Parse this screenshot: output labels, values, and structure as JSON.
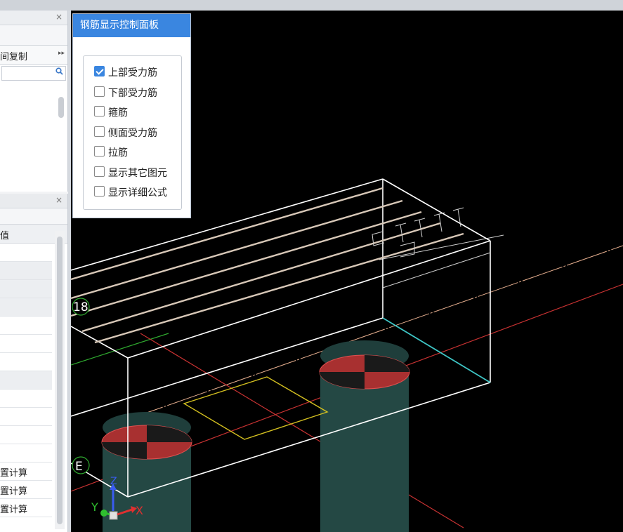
{
  "left_panel_top": {
    "close": "×",
    "menu_label": "间复制",
    "menu_arrow": "▸▸",
    "search_placeholder": ""
  },
  "left_panel_bottom": {
    "close": "×",
    "header": "值",
    "rows": [
      "",
      "",
      "",
      "",
      "",
      "",
      "",
      "",
      "",
      "",
      "",
      "",
      "置计算",
      "置计算",
      "置计算"
    ]
  },
  "control_panel": {
    "title": "钢筋显示控制面板",
    "options": [
      {
        "label": "上部受力筋",
        "checked": true
      },
      {
        "label": "下部受力筋",
        "checked": false
      },
      {
        "label": "箍筋",
        "checked": false
      },
      {
        "label": "侧面受力筋",
        "checked": false
      },
      {
        "label": "拉筋",
        "checked": false
      },
      {
        "label": "显示其它图元",
        "checked": false
      },
      {
        "label": "显示详细公式",
        "checked": false
      }
    ]
  },
  "viewport": {
    "axis_labels": {
      "left_top": "18",
      "left_bottom": "E"
    },
    "gizmo": {
      "x": "X",
      "y": "Y",
      "z": "Z"
    },
    "colors": {
      "beam": "#ffffff",
      "rebar": "#d8c8b8",
      "cap": "#a83030",
      "column": "#244844",
      "axis_red": "#c83232",
      "axis_green": "#2fa92f",
      "highlight_edge": "#3ec6c6",
      "plate": "#d4c020"
    }
  }
}
